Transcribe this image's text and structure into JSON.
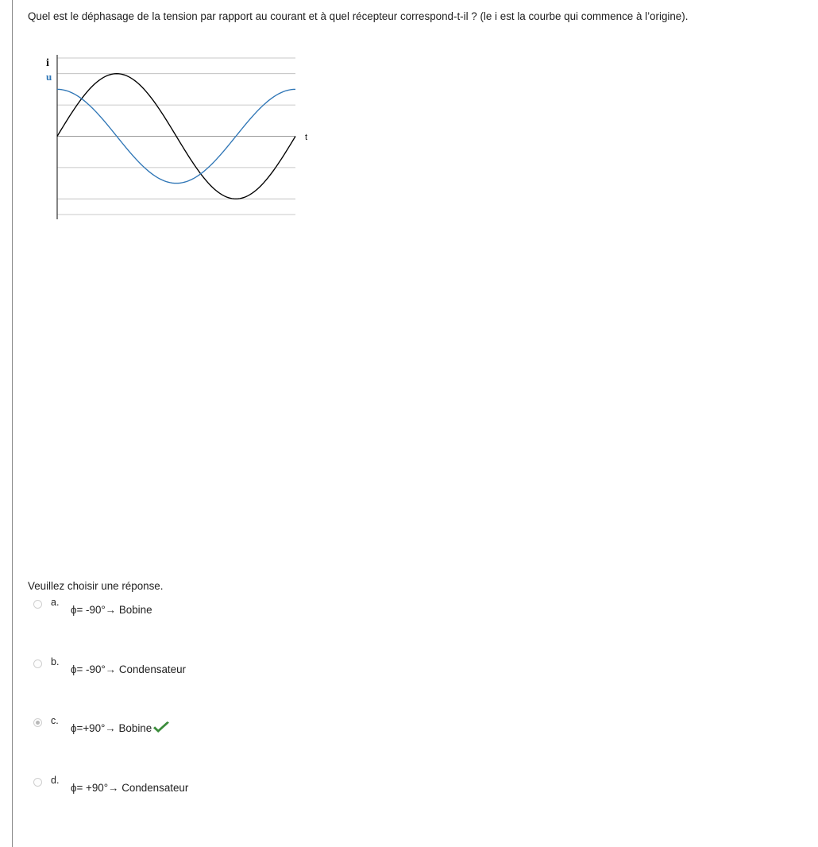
{
  "question": {
    "text": "Quel est le déphasage de la tension par rapport au courant et à quel récepteur correspond-t-il ? (le i est la courbe qui commence à l’origine)."
  },
  "chart_data": {
    "type": "line",
    "labels": {
      "i": "i",
      "u": "u",
      "t": "t"
    },
    "series": [
      {
        "name": "i",
        "color": "#000000",
        "points": [
          [
            0,
            0
          ],
          [
            0.125,
            0.707
          ],
          [
            0.25,
            1
          ],
          [
            0.375,
            0.707
          ],
          [
            0.5,
            0
          ],
          [
            0.625,
            -0.707
          ],
          [
            0.75,
            -1
          ],
          [
            0.875,
            -0.707
          ],
          [
            1,
            0
          ]
        ]
      },
      {
        "name": "u",
        "color": "#2f76b6",
        "points": [
          [
            0,
            0.75
          ],
          [
            0.125,
            0.53
          ],
          [
            0.25,
            0
          ],
          [
            0.375,
            -0.53
          ],
          [
            0.5,
            -0.75
          ],
          [
            0.625,
            -0.53
          ],
          [
            0.75,
            0
          ],
          [
            0.875,
            0.53
          ],
          [
            1,
            0.75
          ]
        ]
      }
    ],
    "xlim": [
      0,
      1
    ],
    "ylim": [
      -1.25,
      1.25
    ],
    "grid": true
  },
  "response": {
    "prompt": "Veuillez choisir une réponse.",
    "options": [
      {
        "letter": "a.",
        "text": "ϕ= -90°→ Bobine",
        "selected": false,
        "correct": false
      },
      {
        "letter": "b.",
        "text": "ϕ= -90°→ Condensateur",
        "selected": false,
        "correct": false
      },
      {
        "letter": "c.",
        "text": "ϕ=+90°→ Bobine",
        "selected": true,
        "correct": true
      },
      {
        "letter": "d.",
        "text": "ϕ= +90°→ Condensateur",
        "selected": false,
        "correct": false
      }
    ]
  },
  "icons": {
    "correct": "check-icon"
  },
  "colors": {
    "current": "#000000",
    "voltage": "#2f76b6",
    "correct": "#3b8c3b"
  }
}
